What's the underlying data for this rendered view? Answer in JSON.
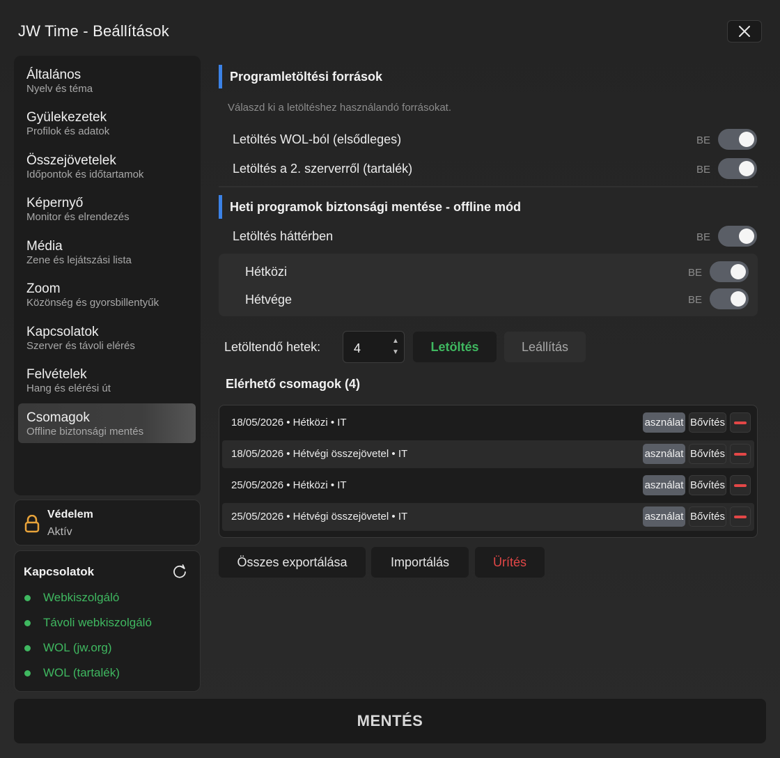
{
  "window": {
    "title": "JW Time - Beállítások"
  },
  "sidebar": {
    "items": [
      {
        "label": "Általános",
        "sub": "Nyelv és téma"
      },
      {
        "label": "Gyülekezetek",
        "sub": "Profilok és adatok"
      },
      {
        "label": "Összejövetelek",
        "sub": "Időpontok és időtartamok"
      },
      {
        "label": "Képernyő",
        "sub": "Monitor és elrendezés"
      },
      {
        "label": "Média",
        "sub": "Zene és lejátszási lista"
      },
      {
        "label": "Zoom",
        "sub": "Közönség és gyorsbillentyűk"
      },
      {
        "label": "Kapcsolatok",
        "sub": "Szerver és távoli elérés"
      },
      {
        "label": "Felvételek",
        "sub": "Hang és elérési út"
      },
      {
        "label": "Csomagok",
        "sub": "Offline biztonsági mentés"
      }
    ],
    "active_index": 8
  },
  "protection": {
    "title": "Védelem",
    "status": "Aktív",
    "icon": "lock-icon"
  },
  "connections": {
    "title": "Kapcsolatok",
    "items": [
      "Webkiszolgáló",
      "Távoli webkiszolgáló",
      "WOL (jw.org)",
      "WOL (tartalék)"
    ],
    "status_color": "#3fb860"
  },
  "sources": {
    "heading": "Programletöltési források",
    "description": "Válaszd ki a letöltéshez használandó forrásokat.",
    "rows": [
      {
        "label": "Letöltés WOL-ból (elsődleges)",
        "state": "BE",
        "on": true
      },
      {
        "label": "Letöltés a 2. szerverről (tartalék)",
        "state": "BE",
        "on": true
      }
    ]
  },
  "backup": {
    "heading": "Heti programok biztonsági mentése - offline mód",
    "background": {
      "label": "Letöltés háttérben",
      "state": "BE",
      "on": true
    },
    "sub": [
      {
        "label": "Hétközi",
        "state": "BE",
        "on": true
      },
      {
        "label": "Hétvége",
        "state": "BE",
        "on": true
      }
    ]
  },
  "weeks": {
    "label": "Letöltendő hetek:",
    "value": "4",
    "download_label": "Letöltés",
    "stop_label": "Leállítás"
  },
  "packages": {
    "title": "Elérhető csomagok (4)",
    "rows": [
      {
        "name": "18/05/2026 • Hétközi • IT",
        "use": "asználat",
        "more": "Bővítés"
      },
      {
        "name": "18/05/2026 • Hétvégi összejövetel • IT",
        "use": "asználat",
        "more": "Bővítés"
      },
      {
        "name": "25/05/2026 • Hétközi • IT",
        "use": "asználat",
        "more": "Bővítés"
      },
      {
        "name": "25/05/2026 • Hétvégi összejövetel • IT",
        "use": "asználat",
        "more": "Bővítés"
      }
    ],
    "export_label": "Összes exportálása",
    "import_label": "Importálás",
    "clear_label": "Ürítés"
  },
  "save_label": "MENTÉS",
  "colors": {
    "accent": "#3b82e6",
    "success": "#3fb860",
    "danger": "#e34747",
    "toggle_on": "#5a5e66"
  }
}
